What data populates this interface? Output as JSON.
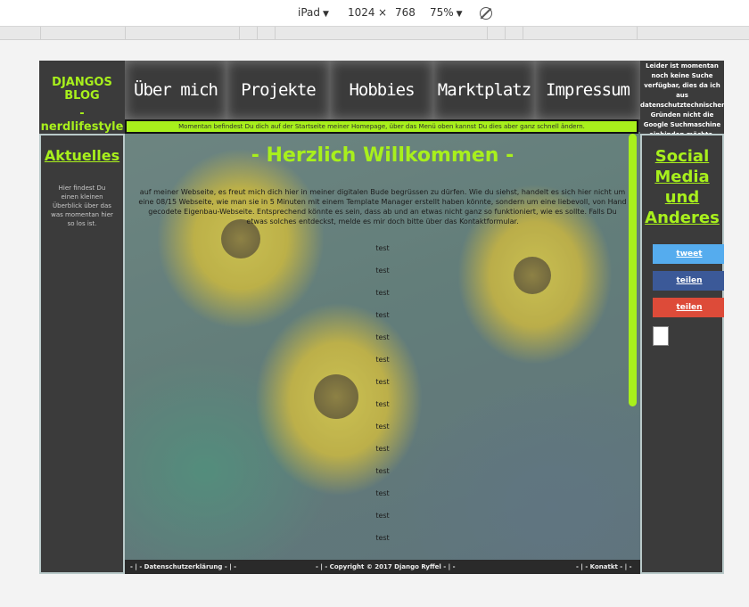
{
  "devtools": {
    "device": "iPad",
    "width": "1024",
    "times": "×",
    "height": "768",
    "zoom": "75%"
  },
  "header": {
    "logo_title": "DJANGOS BLOG",
    "logo_subtitle": "- nerdlifestyle -",
    "nav": [
      "Über mich",
      "Projekte",
      "Hobbies",
      "Marktplatz",
      "Impressum"
    ],
    "notice": "Leider ist momentan noch keine Suche verfügbar, dies da ich aus datenschutztechnischen Gründen nicht die Google Suchmaschine einbinden möchte."
  },
  "status_text": "Momentan befindest Du dich auf der Startseite meiner Homepage, über das Menü oben kannst Du dies aber ganz schnell ändern.",
  "left": {
    "heading": "Aktuelles",
    "text": "Hier findest Du einen kleinen Überblick über das was momentan hier so los ist."
  },
  "main": {
    "title": "- Herzlich Willkommen -",
    "intro": "auf meiner Webseite, es freut mich dich hier in meiner digitalen Bude begrüssen zu dürfen. Wie du siehst, handelt es sich hier nicht um eine 08/15 Webseite, wie man sie in 5 Minuten mit einem Template Manager erstellt haben könnte, sondern um eine liebevoll, von Hand gecodete Eigenbau-Webseite. Entsprechend könnte es sein, dass ab und an etwas nicht ganz so funktioniert, wie es sollte. Falls Du etwas solches entdeckst, melde es mir doch bitte über das Kontaktformular.",
    "tests": [
      "test",
      "test",
      "test",
      "test",
      "test",
      "test",
      "test",
      "test",
      "test",
      "test",
      "test",
      "test",
      "test",
      "test"
    ]
  },
  "right": {
    "heading": "Social Media und Anderes",
    "tweet": "tweet",
    "share_facebook": "teilen",
    "share_google": "teilen"
  },
  "footer": {
    "privacy": "- | - Datenschutzerklärung - | -",
    "copyright": "- | - Copyright © 2017 Django Ryffel - | -",
    "contact": "- | - Konatkt - | -"
  },
  "colors": {
    "accent": "#a8f01c",
    "dark": "#3b3b3b",
    "tweet": "#55acee",
    "facebook": "#3b5998",
    "google": "#dd4b39"
  }
}
